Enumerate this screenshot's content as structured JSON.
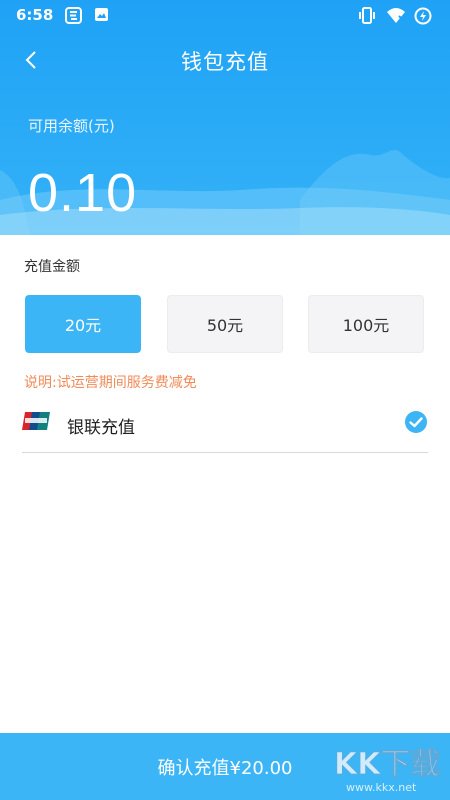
{
  "statusbar": {
    "time": "6:58"
  },
  "header": {
    "title": "钱包充值"
  },
  "balance": {
    "label": "可用余额(元)",
    "value": "0.10"
  },
  "recharge": {
    "section_label": "充值金额",
    "amounts": [
      {
        "label": "20元",
        "selected": true
      },
      {
        "label": "50元",
        "selected": false
      },
      {
        "label": "100元",
        "selected": false
      }
    ],
    "note": "说明:试运营期间服务费减免"
  },
  "payment": {
    "method_label": "银联充值",
    "selected": true
  },
  "footer": {
    "confirm_label": "确认充值¥20.00"
  },
  "watermark": {
    "text": "KK下载",
    "url": "www.kkx.net"
  },
  "colors": {
    "primary": "#3cb5f6",
    "note": "#f08b5a"
  }
}
